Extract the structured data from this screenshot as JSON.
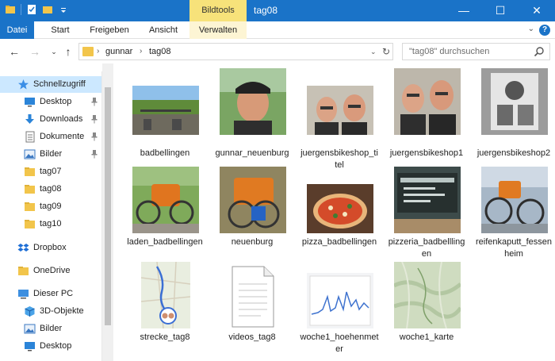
{
  "window": {
    "title": "tag08",
    "context_group": "Bildtools",
    "minimize": "—",
    "maximize": "☐",
    "close": "✕"
  },
  "ribbon": {
    "tabs": [
      {
        "label": "Datei"
      },
      {
        "label": "Start"
      },
      {
        "label": "Freigeben"
      },
      {
        "label": "Ansicht"
      },
      {
        "label": "Verwalten"
      }
    ]
  },
  "address": {
    "crumbs": [
      "gunnar",
      "tag08"
    ]
  },
  "search": {
    "placeholder": "\"tag08\" durchsuchen"
  },
  "nav": {
    "items": [
      {
        "label": "Schnellzugriff",
        "icon": "star-icon"
      },
      {
        "label": "Desktop",
        "icon": "desktop-icon",
        "pinned": true
      },
      {
        "label": "Downloads",
        "icon": "download-icon",
        "pinned": true
      },
      {
        "label": "Dokumente",
        "icon": "document-icon",
        "pinned": true
      },
      {
        "label": "Bilder",
        "icon": "pictures-icon",
        "pinned": true
      },
      {
        "label": "tag07",
        "icon": "folder-icon"
      },
      {
        "label": "tag08",
        "icon": "folder-icon"
      },
      {
        "label": "tag09",
        "icon": "folder-icon"
      },
      {
        "label": "tag10",
        "icon": "folder-icon"
      },
      {
        "label": "Dropbox",
        "icon": "dropbox-icon"
      },
      {
        "label": "OneDrive",
        "icon": "folder-icon"
      },
      {
        "label": "Dieser PC",
        "icon": "computer-icon"
      },
      {
        "label": "3D-Objekte",
        "icon": "cube-icon"
      },
      {
        "label": "Bilder",
        "icon": "pictures-icon"
      },
      {
        "label": "Desktop",
        "icon": "desktop-icon"
      }
    ]
  },
  "files": [
    {
      "name": "badbellingen",
      "kind": "photo"
    },
    {
      "name": "gunnar_neuenburg",
      "kind": "photo"
    },
    {
      "name": "juergensbikeshop_titel",
      "kind": "photo"
    },
    {
      "name": "juergensbikeshop1",
      "kind": "photo"
    },
    {
      "name": "juergensbikeshop2",
      "kind": "photo"
    },
    {
      "name": "laden_badbellingen",
      "kind": "photo"
    },
    {
      "name": "neuenburg",
      "kind": "photo"
    },
    {
      "name": "pizza_badbellingen",
      "kind": "photo"
    },
    {
      "name": "pizzeria_badbelllingen",
      "kind": "photo"
    },
    {
      "name": "reifenkaputt_fessenheim",
      "kind": "photo"
    },
    {
      "name": "strecke_tag8",
      "kind": "map"
    },
    {
      "name": "videos_tag8",
      "kind": "document"
    },
    {
      "name": "woche1_hoehenmeter",
      "kind": "graph"
    },
    {
      "name": "woche1_karte",
      "kind": "map"
    }
  ],
  "colors": {
    "titlebar": "#1a73c8",
    "context_tab": "#f7e27a",
    "selection": "#cce8ff",
    "folder": "#f2c54b"
  }
}
